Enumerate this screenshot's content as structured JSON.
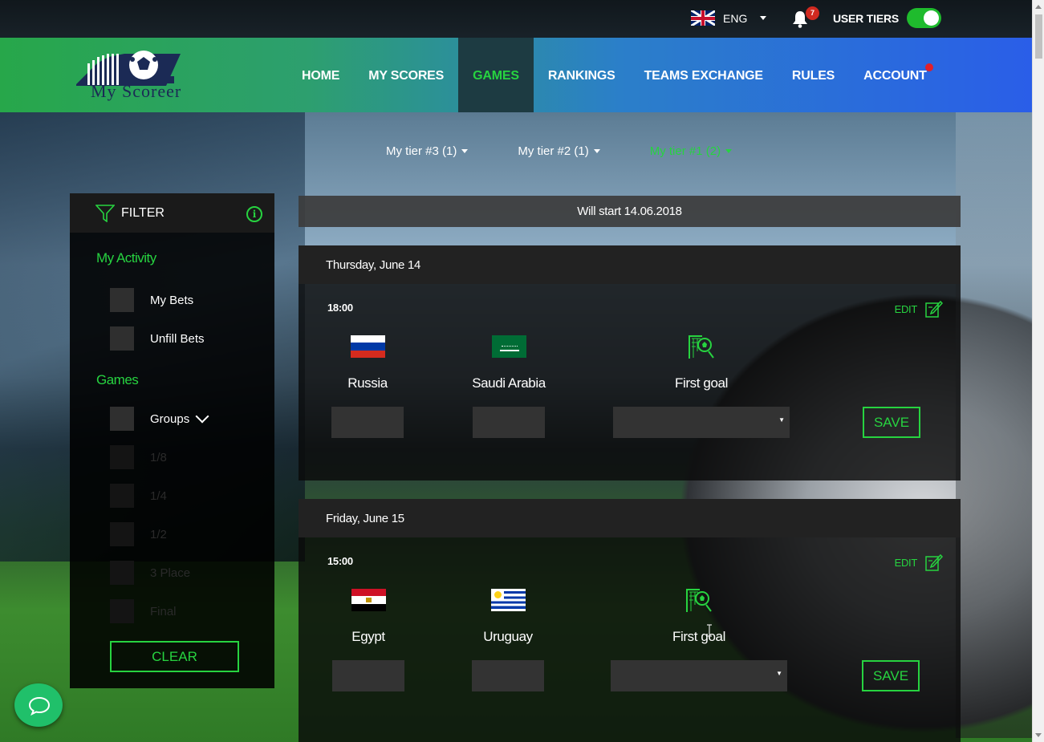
{
  "topbar": {
    "language": "ENG",
    "notification_count": "7",
    "user_tiers_label": "USER TIERS",
    "user_tiers_enabled": true
  },
  "brand": {
    "logo_text": "My Scoreer"
  },
  "nav": {
    "items": [
      {
        "label": "HOME",
        "active": false
      },
      {
        "label": "MY SCORES",
        "active": false
      },
      {
        "label": "GAMES",
        "active": true
      },
      {
        "label": "RANKINGS",
        "active": false
      },
      {
        "label": "TEAMS EXCHANGE",
        "active": false
      },
      {
        "label": "RULES",
        "active": false
      },
      {
        "label": "ACCOUNT",
        "active": false
      }
    ]
  },
  "tiers": [
    {
      "label": "My tier #3 (1)",
      "active": false
    },
    {
      "label": "My tier #2 (1)",
      "active": false
    },
    {
      "label": "My tier #1 (2)",
      "active": true
    }
  ],
  "filter": {
    "title": "FILTER",
    "my_activity_title": "My Activity",
    "my_activity_items": [
      "My Bets",
      "Unfill Bets"
    ],
    "games_title": "Games",
    "games_items": [
      "Groups",
      "1/8",
      "1/4",
      "1/2",
      "3 Place",
      "Final"
    ],
    "clear_label": "CLEAR"
  },
  "main": {
    "banner": "Will start 14.06.2018",
    "days": [
      {
        "date": "Thursday, June 14",
        "time": "18:00",
        "edit_label": "EDIT",
        "home": "Russia",
        "away": "Saudi Arabia",
        "first_goal_label": "First goal",
        "save_label": "SAVE"
      },
      {
        "date": "Friday, June 15",
        "time": "15:00",
        "edit_label": "EDIT",
        "home": "Egypt",
        "away": "Uruguay",
        "first_goal_label": "First goal",
        "save_label": "SAVE"
      }
    ]
  },
  "colors": {
    "accent_green": "#27d340",
    "nav_active_bg": "#1d3b42",
    "badge_red": "#d12a20"
  }
}
